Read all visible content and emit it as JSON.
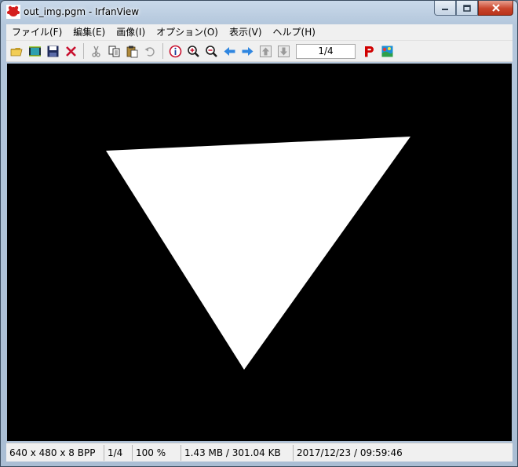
{
  "window": {
    "title": "out_img.pgm - IrfanView"
  },
  "menu": [
    "ファイル(F)",
    "編集(E)",
    "画像(I)",
    "オプション(O)",
    "表示(V)",
    "ヘルプ(H)"
  ],
  "toolbar": {
    "page_indicator": "1/4",
    "icons": [
      "open-folder-icon",
      "slideshow-icon",
      "save-icon",
      "delete-icon",
      "cut-icon",
      "copy-icon",
      "paste-icon",
      "undo-icon",
      "info-icon",
      "zoom-in-icon",
      "zoom-out-icon",
      "previous-icon",
      "next-icon",
      "page-up-icon",
      "page-down-icon",
      "print-icon",
      "about-icon"
    ]
  },
  "image": {
    "background": "#000000",
    "shape_color": "#ffffff"
  },
  "status": {
    "dimensions": "640 x 480 x 8 BPP",
    "page": "1/4",
    "zoom": "100 %",
    "size": "1.43 MB / 301.04 KB",
    "datetime": "2017/12/23 / 09:59:46"
  },
  "colors": {
    "accent_blue": "#2f86e0",
    "delete_red": "#c8102e",
    "print_red": "#d00000",
    "close_button": "#c9452c"
  }
}
